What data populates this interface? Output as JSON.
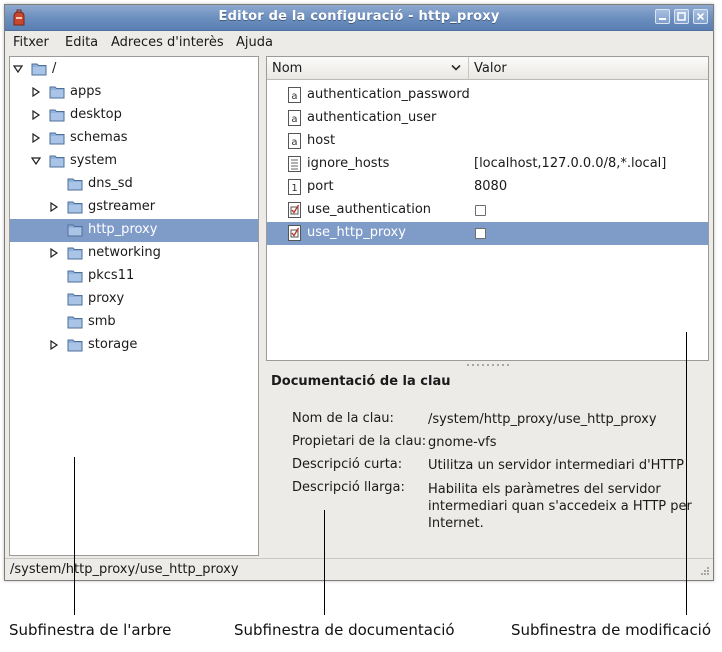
{
  "window": {
    "title": "Editor de la configuració - http_proxy"
  },
  "menu": [
    {
      "name": "menu-fitxer",
      "label": "Fitxer"
    },
    {
      "name": "menu-edita",
      "label": "Edita"
    },
    {
      "name": "menu-adreces",
      "label": "Adreces d'interès"
    },
    {
      "name": "menu-ajuda",
      "label": "Ajuda"
    }
  ],
  "tree": [
    {
      "label": "/",
      "depth": 0,
      "expander": "open",
      "selected": false
    },
    {
      "label": "apps",
      "depth": 1,
      "expander": "closed",
      "selected": false
    },
    {
      "label": "desktop",
      "depth": 1,
      "expander": "closed",
      "selected": false
    },
    {
      "label": "schemas",
      "depth": 1,
      "expander": "closed",
      "selected": false
    },
    {
      "label": "system",
      "depth": 1,
      "expander": "open",
      "selected": false
    },
    {
      "label": "dns_sd",
      "depth": 2,
      "expander": "none",
      "selected": false
    },
    {
      "label": "gstreamer",
      "depth": 2,
      "expander": "closed",
      "selected": false
    },
    {
      "label": "http_proxy",
      "depth": 2,
      "expander": "none",
      "selected": true
    },
    {
      "label": "networking",
      "depth": 2,
      "expander": "closed",
      "selected": false
    },
    {
      "label": "pkcs11",
      "depth": 2,
      "expander": "none",
      "selected": false
    },
    {
      "label": "proxy",
      "depth": 2,
      "expander": "none",
      "selected": false
    },
    {
      "label": "smb",
      "depth": 2,
      "expander": "none",
      "selected": false
    },
    {
      "label": "storage",
      "depth": 2,
      "expander": "closed",
      "selected": false
    }
  ],
  "keys": {
    "headers": {
      "name": "Nom",
      "value": "Valor"
    },
    "rows": [
      {
        "name": "authentication_password",
        "type": "string",
        "value": "",
        "selected": false
      },
      {
        "name": "authentication_user",
        "type": "string",
        "value": "",
        "selected": false
      },
      {
        "name": "host",
        "type": "string",
        "value": "",
        "selected": false
      },
      {
        "name": "ignore_hosts",
        "type": "list",
        "value": "[localhost,127.0.0.0/8,*.local]",
        "selected": false
      },
      {
        "name": "port",
        "type": "integer",
        "value": "8080",
        "selected": false
      },
      {
        "name": "use_authentication",
        "type": "boolean",
        "value": "false",
        "selected": false
      },
      {
        "name": "use_http_proxy",
        "type": "boolean",
        "value": "false",
        "selected": true
      }
    ]
  },
  "doc": {
    "title": "Documentació de la clau",
    "key_name_label": "Nom de la clau:",
    "key_name_value": "/system/http_proxy/use_http_proxy",
    "owner_label": "Propietari de la clau:",
    "owner_value": "gnome-vfs",
    "short_label": "Descripció curta:",
    "short_value": "Utilitza un servidor intermediari d'HTTP",
    "long_label": "Descripció llarga:",
    "long_value_lines": [
      "Habilita els paràmetres del servidor",
      "intermediari quan s'accedeix a HTTP per",
      "Internet."
    ]
  },
  "status": {
    "path": "/system/http_proxy/use_http_proxy"
  },
  "annotations": {
    "tree": "Subfinestra de l'arbre",
    "doc": "Subfinestra de documentació",
    "modify": "Subfinestra de modificació"
  },
  "colors": {
    "titlebar": "#6a8dbe",
    "selection": "#7f9bc8",
    "window_bg": "#ecebe8"
  }
}
